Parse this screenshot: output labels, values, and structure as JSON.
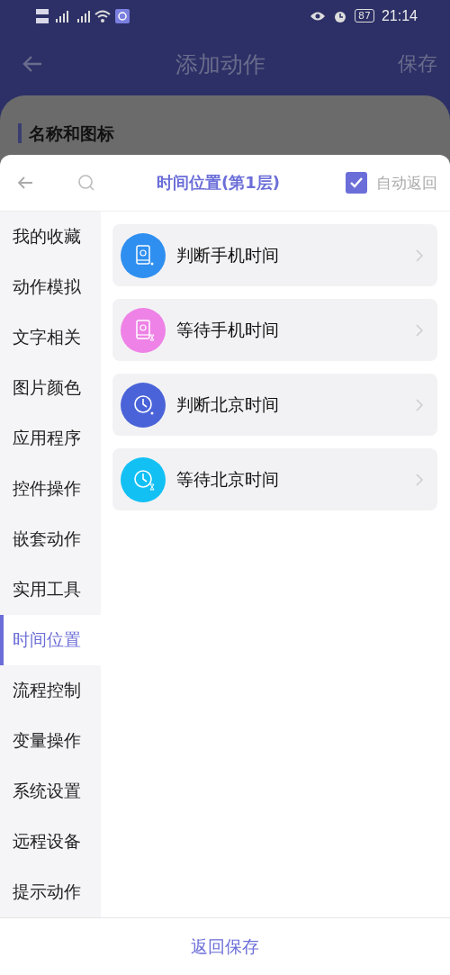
{
  "status_bar": {
    "battery": "87",
    "time": "21:14"
  },
  "header": {
    "title": "添加动作",
    "save": "保存"
  },
  "section": {
    "title": "名称和图标"
  },
  "sheet": {
    "title": "时间位置(第1层)",
    "auto_return": {
      "label": "自动返回",
      "checked": true
    },
    "categories": [
      {
        "label": "我的收藏",
        "selected": false
      },
      {
        "label": "动作模拟",
        "selected": false
      },
      {
        "label": "文字相关",
        "selected": false
      },
      {
        "label": "图片颜色",
        "selected": false
      },
      {
        "label": "应用程序",
        "selected": false
      },
      {
        "label": "控件操作",
        "selected": false
      },
      {
        "label": "嵌套动作",
        "selected": false
      },
      {
        "label": "实用工具",
        "selected": false
      },
      {
        "label": "时间位置",
        "selected": true
      },
      {
        "label": "流程控制",
        "selected": false
      },
      {
        "label": "变量操作",
        "selected": false
      },
      {
        "label": "系统设置",
        "selected": false
      },
      {
        "label": "远程设备",
        "selected": false
      },
      {
        "label": "提示动作",
        "selected": false
      }
    ],
    "actions": [
      {
        "label": "判断手机时间",
        "kind": "phone",
        "color": "#2f8ff0"
      },
      {
        "label": "等待手机时间",
        "kind": "phone-wait",
        "color": "#ee82e6"
      },
      {
        "label": "判断北京时间",
        "kind": "clock",
        "color": "#4a63d8"
      },
      {
        "label": "等待北京时间",
        "kind": "clock-wait",
        "color": "#12c0f4"
      }
    ],
    "footer": {
      "button": "返回保存"
    }
  }
}
